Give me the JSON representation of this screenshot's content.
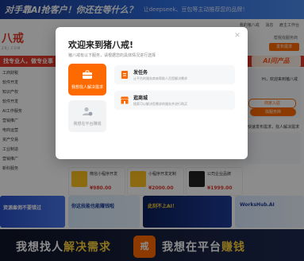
{
  "colors": {
    "brand": "#e4392b",
    "accent": "#ff6a00",
    "overlay": "rgba(0,0,0,0.45)"
  },
  "top_banner": {
    "headline": "对手靠AI抢客户！你还在等什么？",
    "sub": "让deepseek、豆包等主动推荐您的品牌！"
  },
  "nav": {
    "links": [
      "我的猪八戒",
      "消息",
      "雇主工作台"
    ]
  },
  "logo": {
    "text": "八戒",
    "sub": "ZBJ.COM"
  },
  "header": {
    "right_text": "帮我找服务商",
    "publish_button": "发布需求"
  },
  "category_bar": {
    "title": "找专业人，做专业事"
  },
  "categories": [
    "工商财税",
    "软件开发",
    "知识产权",
    "软件开发",
    "AI工作服务",
    "营销推广",
    "电商运营",
    "资产交易",
    "工业制造",
    "营销推广",
    "新科服务"
  ],
  "right_panel": {
    "aiwt": "AI问产品",
    "greeting": "Hi，欢迎来到猪八戒",
    "join_btn": "商家入驻",
    "find_btn": "找服务商",
    "cta": "快速发布需求，找人解决需求"
  },
  "cards": [
    {
      "title": "微信小程序开发",
      "price": "¥980.00"
    },
    {
      "title": "小程序开发定制",
      "price": "¥2000.00"
    },
    {
      "title": "公司企业品牌",
      "price": "¥1999.00"
    }
  ],
  "lower_banners": [
    {
      "text": "资源雇佣不要错过"
    },
    {
      "text": "你这技能也能赚钱啦"
    },
    {
      "text": "此刻不上AI！"
    },
    {
      "text": "WorksHub.AI"
    }
  ],
  "bottom_ad": {
    "left_prefix": "我想找人",
    "left_highlight": "解决需求",
    "mid_icon_text": "戒",
    "right_prefix": "我想在平台",
    "right_highlight": "赚钱"
  },
  "modal": {
    "title": "欢迎来到猪八戒!",
    "subtitle": "猪八戒有以下服务，请根据您的具体情况进行选择",
    "close_icon": "close-icon",
    "roles": [
      {
        "label": "我想找人解决需求",
        "icon": "employer-icon",
        "selected": true
      },
      {
        "label": "我想在平台赚钱",
        "icon": "provider-icon",
        "selected": false
      }
    ],
    "options": [
      {
        "title": "发任务",
        "desc": "让平台的服务商来帮助人员您解决需求",
        "icon": "publish-task-icon"
      },
      {
        "title": "逛商城",
        "desc": "搜索可以解决您需求的服务并进行购买",
        "icon": "mall-icon"
      }
    ]
  }
}
